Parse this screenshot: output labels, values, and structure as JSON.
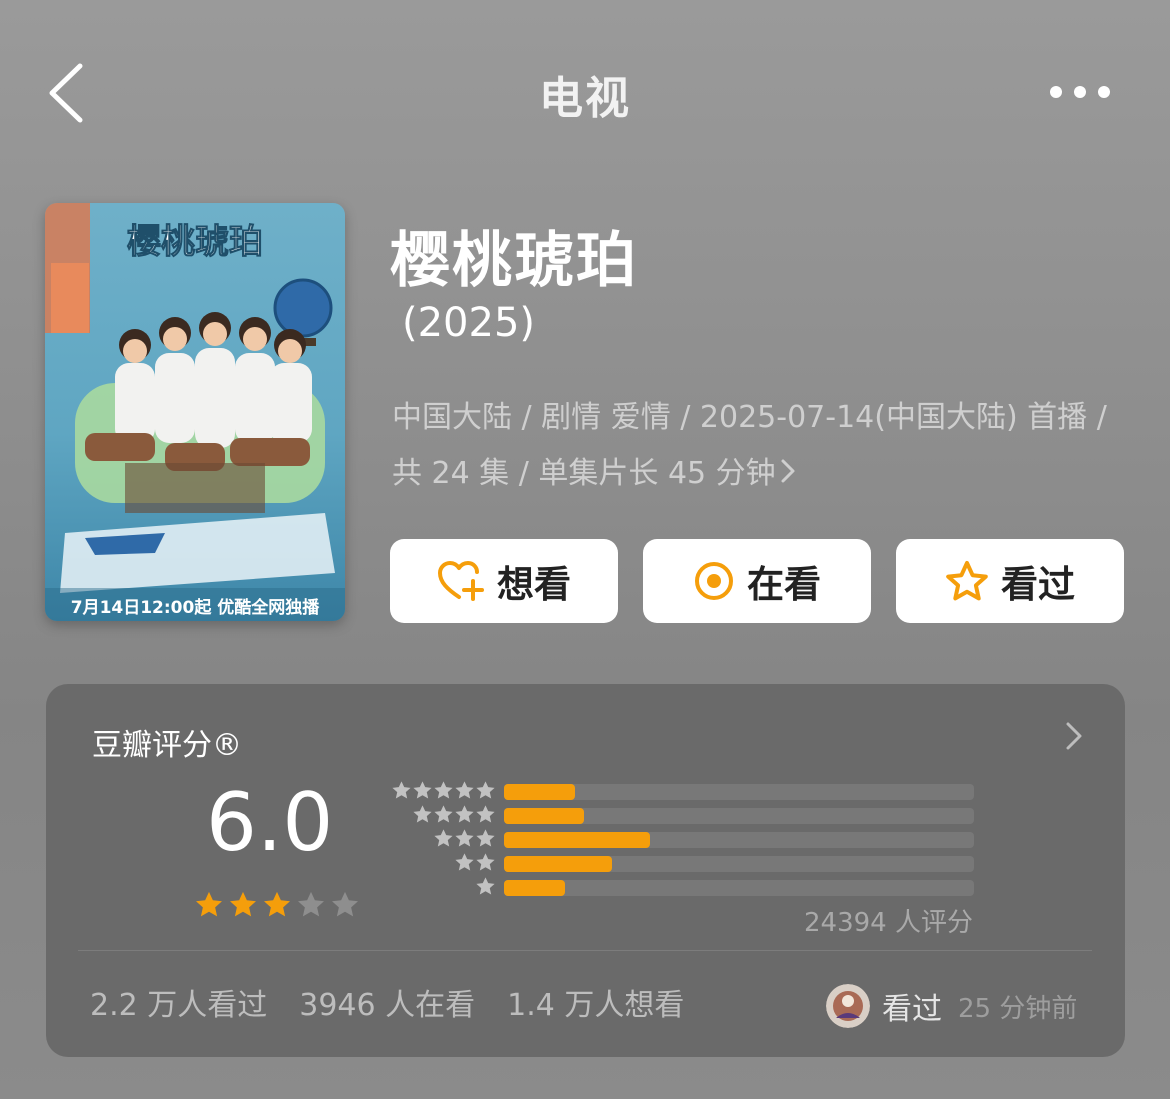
{
  "nav": {
    "title": "电视",
    "back_icon": "chevron-left-icon",
    "more_icon": "more-horizontal-icon"
  },
  "poster": {
    "logo_text": "樱桃琥珀",
    "caption": "7月14日12:00起 优酷全网独播"
  },
  "show": {
    "title": "樱桃琥珀",
    "year": " (2025)",
    "meta": "中国大陆 / 剧情 爱情 / 2025-07-14(中国大陆) 首播 / 共 24 集 / 单集片长 45 分钟"
  },
  "actions": [
    {
      "label": "想看",
      "icon": "heart-plus-icon"
    },
    {
      "label": "在看",
      "icon": "target-icon"
    },
    {
      "label": "看过",
      "icon": "star-outline-icon"
    }
  ],
  "colors": {
    "accent": "#f59e0b",
    "card_bg": "#6a6a6a",
    "empty_star": "#8e8e8e"
  },
  "rating": {
    "title": "豆瓣评分®",
    "score": "6.0",
    "stars_filled": 3,
    "stars_total": 5,
    "distribution": [
      {
        "stars": 5,
        "percent": 15
      },
      {
        "stars": 4,
        "percent": 17
      },
      {
        "stars": 3,
        "percent": 31
      },
      {
        "stars": 2,
        "percent": 23
      },
      {
        "stars": 1,
        "percent": 13
      }
    ],
    "count_text": "24394 人评分",
    "stats": [
      "2.2 万人看过",
      "3946 人在看",
      "1.4 万人想看"
    ],
    "friend_status": "看过",
    "friend_time": "25 分钟前"
  }
}
